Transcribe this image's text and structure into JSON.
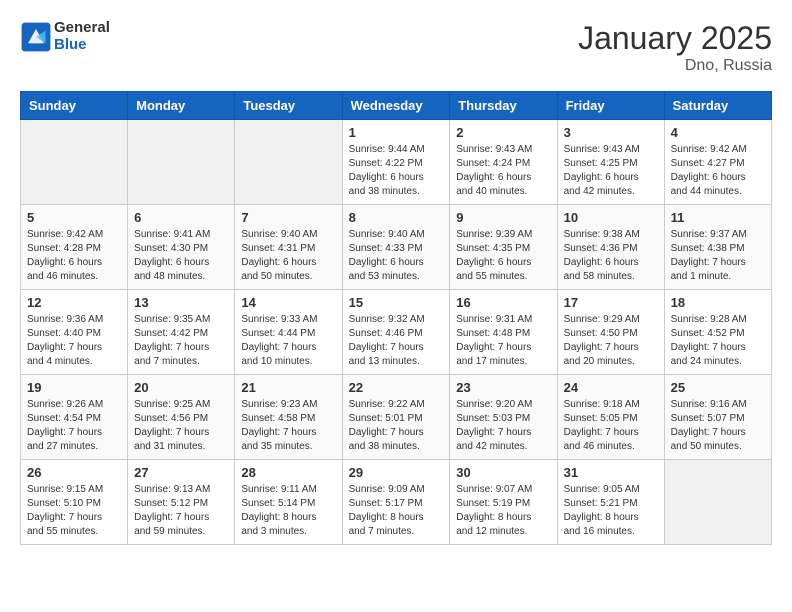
{
  "header": {
    "logo_general": "General",
    "logo_blue": "Blue",
    "month_title": "January 2025",
    "location": "Dno, Russia"
  },
  "days_of_week": [
    "Sunday",
    "Monday",
    "Tuesday",
    "Wednesday",
    "Thursday",
    "Friday",
    "Saturday"
  ],
  "weeks": [
    [
      {
        "day": "",
        "info": ""
      },
      {
        "day": "",
        "info": ""
      },
      {
        "day": "",
        "info": ""
      },
      {
        "day": "1",
        "info": "Sunrise: 9:44 AM\nSunset: 4:22 PM\nDaylight: 6 hours\nand 38 minutes."
      },
      {
        "day": "2",
        "info": "Sunrise: 9:43 AM\nSunset: 4:24 PM\nDaylight: 6 hours\nand 40 minutes."
      },
      {
        "day": "3",
        "info": "Sunrise: 9:43 AM\nSunset: 4:25 PM\nDaylight: 6 hours\nand 42 minutes."
      },
      {
        "day": "4",
        "info": "Sunrise: 9:42 AM\nSunset: 4:27 PM\nDaylight: 6 hours\nand 44 minutes."
      }
    ],
    [
      {
        "day": "5",
        "info": "Sunrise: 9:42 AM\nSunset: 4:28 PM\nDaylight: 6 hours\nand 46 minutes."
      },
      {
        "day": "6",
        "info": "Sunrise: 9:41 AM\nSunset: 4:30 PM\nDaylight: 6 hours\nand 48 minutes."
      },
      {
        "day": "7",
        "info": "Sunrise: 9:40 AM\nSunset: 4:31 PM\nDaylight: 6 hours\nand 50 minutes."
      },
      {
        "day": "8",
        "info": "Sunrise: 9:40 AM\nSunset: 4:33 PM\nDaylight: 6 hours\nand 53 minutes."
      },
      {
        "day": "9",
        "info": "Sunrise: 9:39 AM\nSunset: 4:35 PM\nDaylight: 6 hours\nand 55 minutes."
      },
      {
        "day": "10",
        "info": "Sunrise: 9:38 AM\nSunset: 4:36 PM\nDaylight: 6 hours\nand 58 minutes."
      },
      {
        "day": "11",
        "info": "Sunrise: 9:37 AM\nSunset: 4:38 PM\nDaylight: 7 hours\nand 1 minute."
      }
    ],
    [
      {
        "day": "12",
        "info": "Sunrise: 9:36 AM\nSunset: 4:40 PM\nDaylight: 7 hours\nand 4 minutes."
      },
      {
        "day": "13",
        "info": "Sunrise: 9:35 AM\nSunset: 4:42 PM\nDaylight: 7 hours\nand 7 minutes."
      },
      {
        "day": "14",
        "info": "Sunrise: 9:33 AM\nSunset: 4:44 PM\nDaylight: 7 hours\nand 10 minutes."
      },
      {
        "day": "15",
        "info": "Sunrise: 9:32 AM\nSunset: 4:46 PM\nDaylight: 7 hours\nand 13 minutes."
      },
      {
        "day": "16",
        "info": "Sunrise: 9:31 AM\nSunset: 4:48 PM\nDaylight: 7 hours\nand 17 minutes."
      },
      {
        "day": "17",
        "info": "Sunrise: 9:29 AM\nSunset: 4:50 PM\nDaylight: 7 hours\nand 20 minutes."
      },
      {
        "day": "18",
        "info": "Sunrise: 9:28 AM\nSunset: 4:52 PM\nDaylight: 7 hours\nand 24 minutes."
      }
    ],
    [
      {
        "day": "19",
        "info": "Sunrise: 9:26 AM\nSunset: 4:54 PM\nDaylight: 7 hours\nand 27 minutes."
      },
      {
        "day": "20",
        "info": "Sunrise: 9:25 AM\nSunset: 4:56 PM\nDaylight: 7 hours\nand 31 minutes."
      },
      {
        "day": "21",
        "info": "Sunrise: 9:23 AM\nSunset: 4:58 PM\nDaylight: 7 hours\nand 35 minutes."
      },
      {
        "day": "22",
        "info": "Sunrise: 9:22 AM\nSunset: 5:01 PM\nDaylight: 7 hours\nand 38 minutes."
      },
      {
        "day": "23",
        "info": "Sunrise: 9:20 AM\nSunset: 5:03 PM\nDaylight: 7 hours\nand 42 minutes."
      },
      {
        "day": "24",
        "info": "Sunrise: 9:18 AM\nSunset: 5:05 PM\nDaylight: 7 hours\nand 46 minutes."
      },
      {
        "day": "25",
        "info": "Sunrise: 9:16 AM\nSunset: 5:07 PM\nDaylight: 7 hours\nand 50 minutes."
      }
    ],
    [
      {
        "day": "26",
        "info": "Sunrise: 9:15 AM\nSunset: 5:10 PM\nDaylight: 7 hours\nand 55 minutes."
      },
      {
        "day": "27",
        "info": "Sunrise: 9:13 AM\nSunset: 5:12 PM\nDaylight: 7 hours\nand 59 minutes."
      },
      {
        "day": "28",
        "info": "Sunrise: 9:11 AM\nSunset: 5:14 PM\nDaylight: 8 hours\nand 3 minutes."
      },
      {
        "day": "29",
        "info": "Sunrise: 9:09 AM\nSunset: 5:17 PM\nDaylight: 8 hours\nand 7 minutes."
      },
      {
        "day": "30",
        "info": "Sunrise: 9:07 AM\nSunset: 5:19 PM\nDaylight: 8 hours\nand 12 minutes."
      },
      {
        "day": "31",
        "info": "Sunrise: 9:05 AM\nSunset: 5:21 PM\nDaylight: 8 hours\nand 16 minutes."
      },
      {
        "day": "",
        "info": ""
      }
    ]
  ]
}
